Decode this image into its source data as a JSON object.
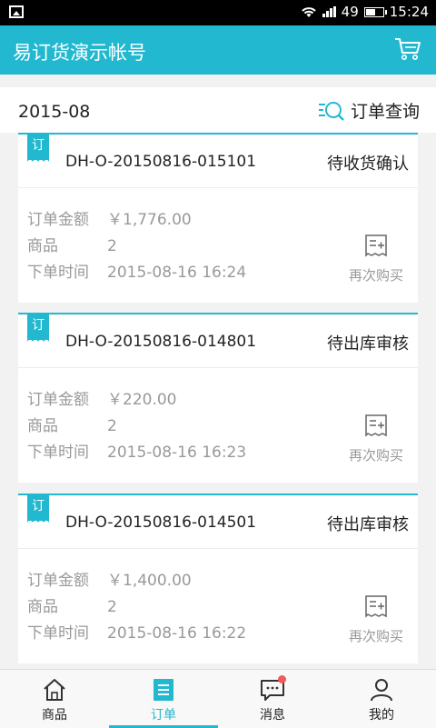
{
  "status_bar": {
    "battery": "49",
    "time": "15:24"
  },
  "header": {
    "title": "易订货演示帐号"
  },
  "filter": {
    "month": "2015-08",
    "search_label": "订单查询"
  },
  "labels": {
    "amount": "订单金额",
    "items": "商品",
    "time": "下单时间",
    "reorder": "再次购买",
    "tag": "订"
  },
  "orders": [
    {
      "order_no": "DH-O-20150816-015101",
      "status": "待收货确认",
      "amount": "￥1,776.00",
      "items": "2",
      "time": "2015-08-16 16:24"
    },
    {
      "order_no": "DH-O-20150816-014801",
      "status": "待出库审核",
      "amount": "￥220.00",
      "items": "2",
      "time": "2015-08-16 16:23"
    },
    {
      "order_no": "DH-O-20150816-014501",
      "status": "待出库审核",
      "amount": "￥1,400.00",
      "items": "2",
      "time": "2015-08-16 16:22"
    }
  ],
  "tabs": [
    {
      "label": "商品",
      "icon": "home-icon"
    },
    {
      "label": "订单",
      "icon": "orders-icon",
      "active": true
    },
    {
      "label": "消息",
      "icon": "message-icon",
      "badge": true
    },
    {
      "label": "我的",
      "icon": "user-icon"
    }
  ],
  "colors": {
    "accent": "#22b9d0",
    "badge": "#f05a5a"
  }
}
